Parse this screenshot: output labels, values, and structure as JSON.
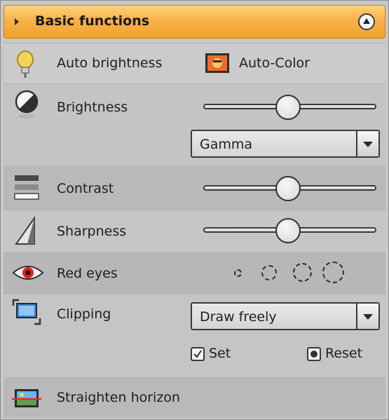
{
  "header": {
    "title": "Basic functions"
  },
  "rows": {
    "auto_brightness": {
      "label": "Auto brightness",
      "auto_color_label": "Auto-Color"
    },
    "brightness": {
      "label": "Brightness",
      "slider_value": 0.5,
      "dropdown_value": "Gamma"
    },
    "contrast": {
      "label": "Contrast",
      "slider_value": 0.5
    },
    "sharpness": {
      "label": "Sharpness",
      "slider_value": 0.5
    },
    "red_eyes": {
      "label": "Red eyes"
    },
    "clipping": {
      "label": "Clipping",
      "dropdown_value": "Draw freely",
      "set_label": "Set",
      "reset_label": "Reset"
    },
    "straighten": {
      "label": "Straighten horizon"
    }
  },
  "colors": {
    "header_orange": "#f6ad3d",
    "panel_bg": "#c9c9c9"
  }
}
